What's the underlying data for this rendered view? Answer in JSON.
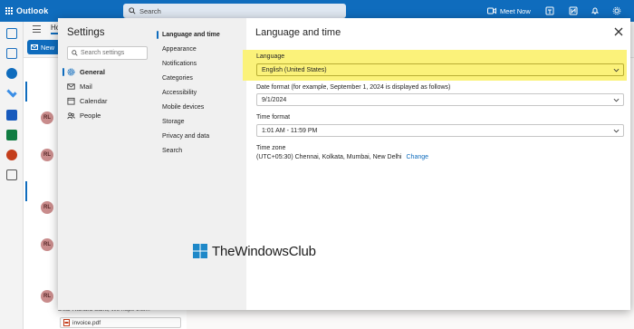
{
  "app": {
    "name": "Outlook",
    "search_placeholder": "Search",
    "meet_now_label": "Meet Now",
    "tab_home": "Ho",
    "new_button_label": "New",
    "accent_color": "#0f6cbd"
  },
  "background": {
    "avatar_initials": "RL",
    "message_snippet": "Dear Richard Saint, We hope this...",
    "attachment_name": "invoice.pdf"
  },
  "settings": {
    "title": "Settings",
    "search_placeholder": "Search settings",
    "categories": [
      {
        "label": "General",
        "icon": "gear-icon",
        "active": true
      },
      {
        "label": "Mail",
        "icon": "mail-icon",
        "active": false
      },
      {
        "label": "Calendar",
        "icon": "calendar-icon",
        "active": false
      },
      {
        "label": "People",
        "icon": "people-icon",
        "active": false
      }
    ],
    "subcategories": [
      {
        "label": "Language and time",
        "active": true
      },
      {
        "label": "Appearance",
        "active": false
      },
      {
        "label": "Notifications",
        "active": false
      },
      {
        "label": "Categories",
        "active": false
      },
      {
        "label": "Accessibility",
        "active": false
      },
      {
        "label": "Mobile devices",
        "active": false
      },
      {
        "label": "Storage",
        "active": false
      },
      {
        "label": "Privacy and data",
        "active": false
      },
      {
        "label": "Search",
        "active": false
      }
    ],
    "panel": {
      "title": "Language and time",
      "language_label": "Language",
      "language_value": "English (United States)",
      "date_format_label": "Date format (for example, September 1, 2024 is displayed as follows)",
      "date_format_value": "9/1/2024",
      "time_format_label": "Time format",
      "time_format_value": "1:01 AM - 11:59 PM",
      "time_zone_label": "Time zone",
      "time_zone_value": "(UTC+05:30) Chennai, Kolkata, Mumbai, New Delhi",
      "time_zone_change_link": "Change",
      "highlight_color": "#fbf27a"
    }
  },
  "watermark": {
    "text": "TheWindowsClub"
  }
}
